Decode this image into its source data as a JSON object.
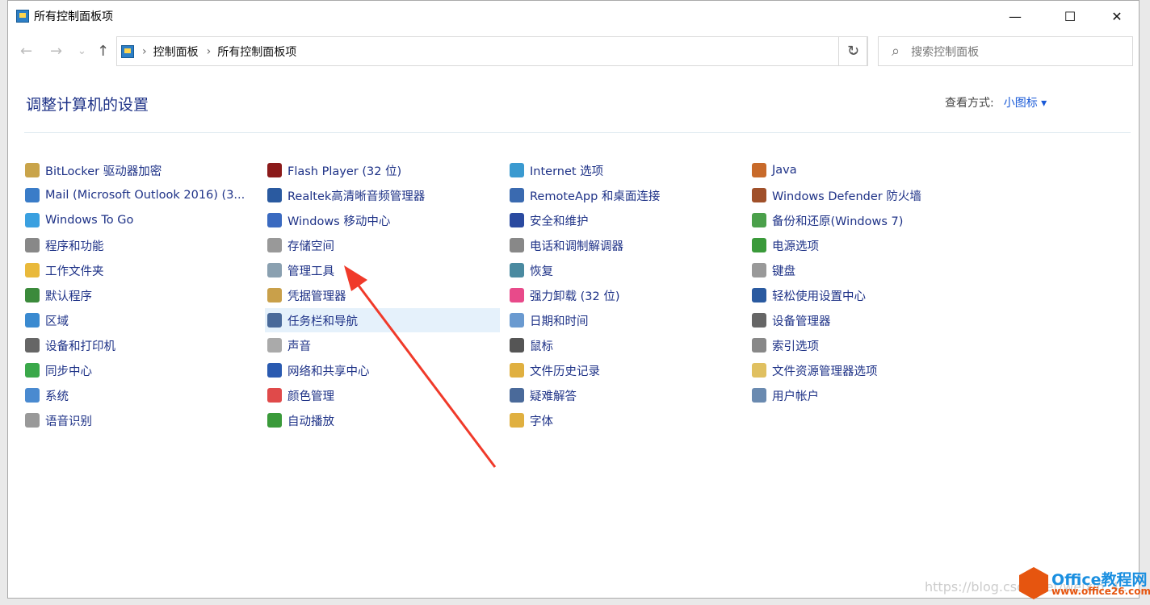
{
  "window": {
    "title": "所有控制面板项",
    "minimize": "—",
    "maximize": "☐",
    "close": "✕"
  },
  "nav": {
    "back": "←",
    "forward": "→",
    "recent": "⌄",
    "up": "↑"
  },
  "address": {
    "crumbs": [
      "控制面板",
      "所有控制面板项"
    ],
    "dropdown": "⌄",
    "refresh": "↻"
  },
  "search": {
    "placeholder": "搜索控制面板",
    "icon": "⌕"
  },
  "heading": "调整计算机的设置",
  "view": {
    "label": "查看方式:",
    "value": "小图标 ▾"
  },
  "columns": [
    [
      [
        "BitLocker 驱动器加密",
        "#c9a44a"
      ],
      [
        "Mail (Microsoft Outlook 2016) (3...",
        "#3a7cc8"
      ],
      [
        "Windows To Go",
        "#3aa0e0"
      ],
      [
        "程序和功能",
        "#888"
      ],
      [
        "工作文件夹",
        "#e9b93b"
      ],
      [
        "默认程序",
        "#3b8a3b"
      ],
      [
        "区域",
        "#3a8ad0"
      ],
      [
        "设备和打印机",
        "#666"
      ],
      [
        "同步中心",
        "#3aa84a"
      ],
      [
        "系统",
        "#4a8ad0"
      ],
      [
        "语音识别",
        "#999"
      ]
    ],
    [
      [
        "Flash Player (32 位)",
        "#8b1a1a"
      ],
      [
        "Realtek高清晰音频管理器",
        "#2a5aa0"
      ],
      [
        "Windows 移动中心",
        "#3a6ac0"
      ],
      [
        "存储空间",
        "#999"
      ],
      [
        "管理工具",
        "#8aa0b0"
      ],
      [
        "凭据管理器",
        "#c9a04a"
      ],
      [
        "任务栏和导航",
        "#4a6a9a"
      ],
      [
        "声音",
        "#aaa"
      ],
      [
        "网络和共享中心",
        "#2a5ab0"
      ],
      [
        "颜色管理",
        "#e04a4a"
      ],
      [
        "自动播放",
        "#3a9a3a"
      ]
    ],
    [
      [
        "Internet 选项",
        "#3a9ad0"
      ],
      [
        "RemoteApp 和桌面连接",
        "#3a6ab0"
      ],
      [
        "安全和维护",
        "#2a4aa0"
      ],
      [
        "电话和调制解调器",
        "#888"
      ],
      [
        "恢复",
        "#4a8aa0"
      ],
      [
        "强力卸载 (32 位)",
        "#e84a8a"
      ],
      [
        "日期和时间",
        "#6a9ad0"
      ],
      [
        "鼠标",
        "#555"
      ],
      [
        "文件历史记录",
        "#e0b040"
      ],
      [
        "疑难解答",
        "#4a6a9a"
      ],
      [
        "字体",
        "#e0b040"
      ]
    ],
    [
      [
        "Java",
        "#c86a2a"
      ],
      [
        "Windows Defender 防火墙",
        "#a0502a"
      ],
      [
        "备份和还原(Windows 7)",
        "#4aa04a"
      ],
      [
        "电源选项",
        "#3a9a3a"
      ],
      [
        "键盘",
        "#999"
      ],
      [
        "轻松使用设置中心",
        "#2a5aa0"
      ],
      [
        "设备管理器",
        "#666"
      ],
      [
        "索引选项",
        "#888"
      ],
      [
        "文件资源管理器选项",
        "#e0c060"
      ],
      [
        "用户帐户",
        "#6a8ab0"
      ],
      []
    ]
  ],
  "selected": "任务栏和导航",
  "watermark": {
    "url": "https://blog.csdn.net/weixin_4...",
    "brand": "Office教程网",
    "site": "www.office26.com"
  }
}
